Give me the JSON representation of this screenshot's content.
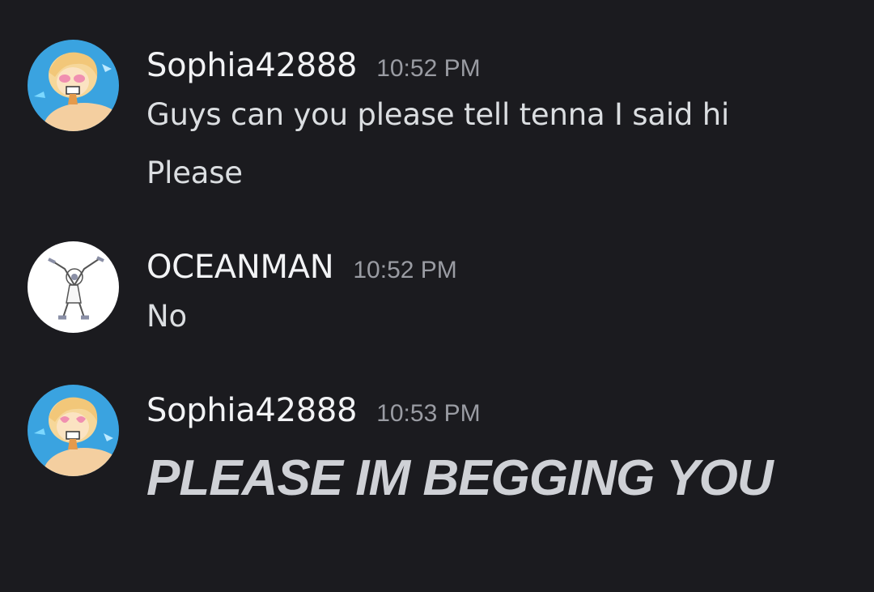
{
  "messages": [
    {
      "author": "Sophia42888",
      "time": "10:52 PM",
      "avatar_icon": "anime-avatar-icon",
      "lines": [
        "Guys can you please tell tenna I said hi",
        "Please"
      ]
    },
    {
      "author": "OCEANMAN",
      "time": "10:52 PM",
      "avatar_icon": "stick-figure-avatar-icon",
      "lines": [
        "No"
      ]
    },
    {
      "author": "Sophia42888",
      "time": "10:53 PM",
      "avatar_icon": "anime-avatar-icon",
      "lines": [
        "PLEASE IM BEGGING YOU"
      ]
    }
  ],
  "colors": {
    "background": "#1b1b1f",
    "username": "#f2f3f5",
    "timestamp": "#9a9ca3",
    "message_text": "#dbdee1"
  }
}
